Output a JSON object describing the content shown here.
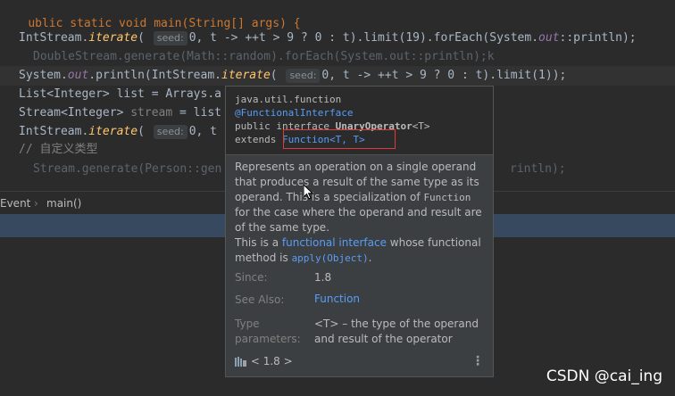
{
  "editor": {
    "line0": "ublic static void main(String[] args) {",
    "l1_a": "IntStream.",
    "l1_iter": "iterate",
    "l1_hint": "seed:",
    "l1_b": "0, t -> ++t > 9 ? 0 : t).limit(19).forEach(System.",
    "l1_out": "out",
    "l1_c": "::println);",
    "l2": "DoubleStream.generate(Math::random).forEach(System.out::println);k",
    "l3_a": "System.",
    "l3_out": "out",
    "l3_b": ".println(IntStream.",
    "l3_iter": "iterate",
    "l3_hint": "seed:",
    "l3_c": "0, t -> ++t > 9 ? 0 : t).limit(1));",
    "l4": "List<Integer> list = Arrays.a",
    "l5_a": "Stream<Integer> ",
    "l5_b": "stream",
    "l5_c": " = list",
    "l6_a": "IntStream.",
    "l6_iter": "iterate",
    "l6_hint": "seed:",
    "l6_b": "0, t",
    "l7": "// 自定义类型",
    "l8_a": "Stream.generate(Person::gen",
    "l8_b": "rintln);"
  },
  "breadcrumb": {
    "item1": "Event",
    "sep": "›",
    "item2": "main()"
  },
  "popup": {
    "package": "java.util.function",
    "annotation": "@FunctionalInterface",
    "decl_prefix": "public interface ",
    "decl_name": "UnaryOperator",
    "decl_suffix": "<T>",
    "extends_kw": "extends ",
    "extends_link": "Function<T, T>",
    "desc1": "Represents an operation on a single operand that produces a result of the same type as its operand. This is a specialization of ",
    "desc_code": "Function",
    "desc2": " for the case where the operand and result are of the same type.",
    "desc3": "This is a ",
    "desc_link": "functional interface",
    "desc4": " whose functional method is ",
    "desc_method": "apply(Object)",
    "desc5": ".",
    "since_label": "Since:",
    "since_value": "1.8",
    "see_label": "See Also:",
    "see_value": "Function",
    "type_label_1": "Type",
    "type_label_2": "parameters:",
    "type_value_1": "<T> – the type of the operand",
    "type_value_2": "and result of the operator",
    "jdk": "< 1.8 >",
    "more": "⋮"
  },
  "watermark": "CSDN @cai_ing",
  "icons": [
    "library-icon",
    "more-options-icon",
    "mouse-cursor-icon"
  ]
}
